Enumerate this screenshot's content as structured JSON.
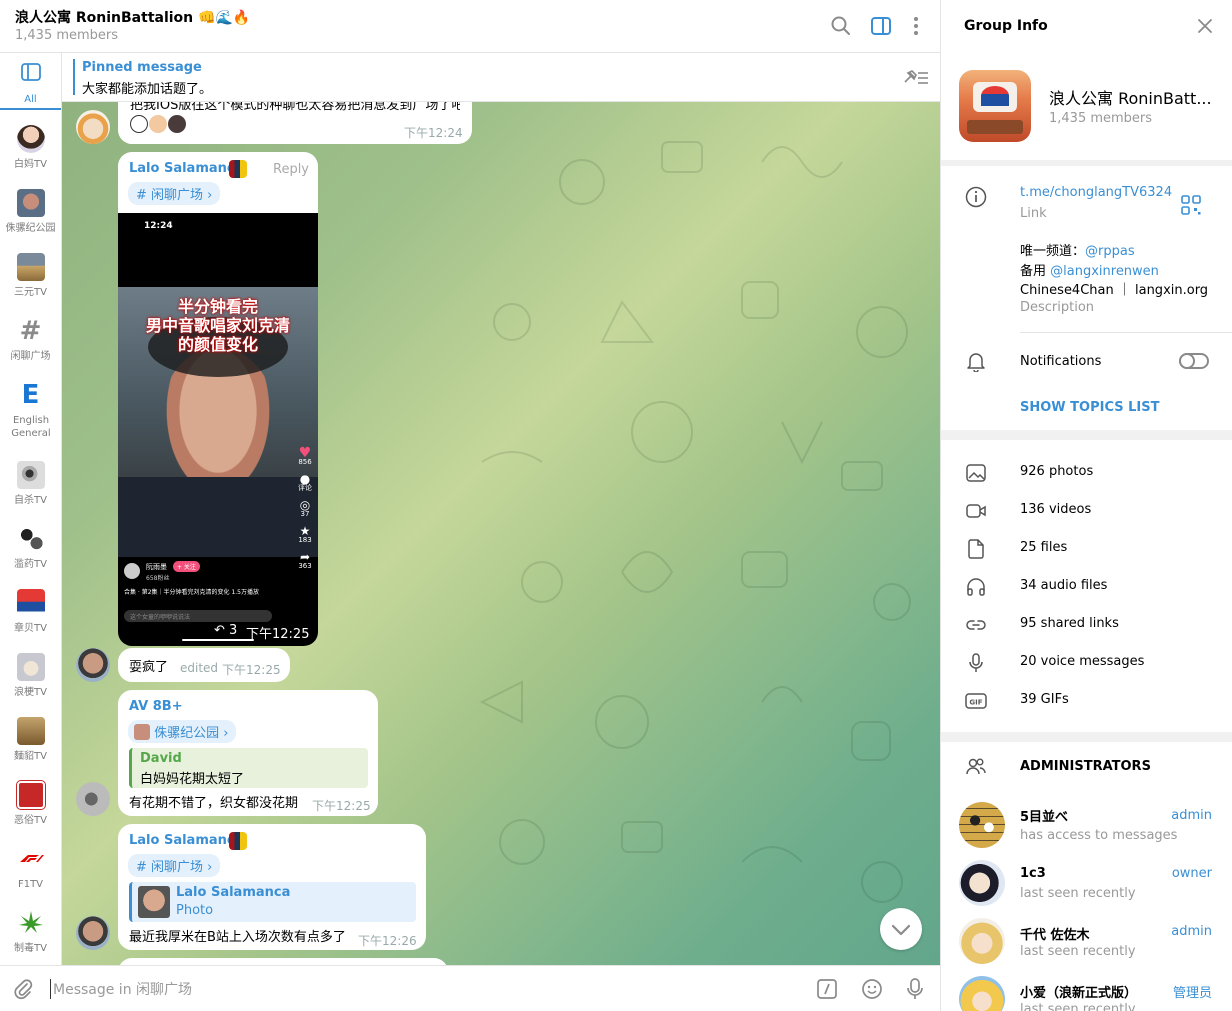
{
  "chat": {
    "title": "浪人公寓 RoninBattalion 👊🌊🔥",
    "subtitle": "1,435 members",
    "pinned": {
      "label": "Pinned message",
      "text": "大家都能添加话题了。"
    },
    "composer_placeholder": "Message in 闲聊广场"
  },
  "topics": [
    {
      "label": "All"
    },
    {
      "label": "白妈TV"
    },
    {
      "label": "侏骡纪公园"
    },
    {
      "label": "三元TV"
    },
    {
      "label": "闲聊广场"
    },
    {
      "label": "English General"
    },
    {
      "label": "自杀TV"
    },
    {
      "label": "滥药TV"
    },
    {
      "label": "章贝TV"
    },
    {
      "label": "浪梗TV"
    },
    {
      "label": "麵貂TV"
    },
    {
      "label": "恶俗TV"
    },
    {
      "label": "F1TV"
    },
    {
      "label": "制毒TV"
    }
  ],
  "messages": {
    "m0": {
      "partial_text": "把我IOS版往这个模式的种聊也太容易把消息发到广场了吧",
      "time": "下午12:24"
    },
    "m1": {
      "sender": "Lalo Salamanca",
      "reply": "Reply",
      "topic": "# 闲聊广场 ›",
      "video": {
        "status_time": "12:24",
        "caption": "半分钟看完\n男中音歌唱家刘克清\n的颜值变化",
        "likes": "856",
        "comments": "评论",
        "shares": "37",
        "stars": "183",
        "forwards": "363",
        "author": "阮雨墨",
        "follow": "+ 关注",
        "fans": "658粉丝",
        "collection": "合集 · 第2集｜半分钟看完刘克清的变化 1.5万播放",
        "comment_box": "这个女童的咿咿说说法",
        "replies": "3",
        "time": "下午12:25"
      }
    },
    "m2": {
      "text": "耍疯了",
      "edited": "edited",
      "time": "下午12:25"
    },
    "m3": {
      "sender": "AV 8B+",
      "topic": "侏骡纪公园 ›",
      "quote_name": "David",
      "quote_text": "白妈妈花期太短了",
      "text": "有花期不错了，织女都没花期",
      "time": "下午12:25"
    },
    "m4": {
      "sender": "Lalo Salamanca",
      "topic": "# 闲聊广场 ›",
      "quote_name": "Lalo Salamanca",
      "quote_text": "Photo",
      "text": "最近我厚米在B站上入场次数有点多了",
      "time": "下午12:26"
    }
  },
  "info": {
    "header": "Group Info",
    "name": "浪人公寓 RoninBatt...",
    "members": "1,435 members",
    "link": "t.me/chonglangTV6324",
    "link_label": "Link",
    "desc_line1_prefix": "唯一频道：",
    "desc_line1_link": "@rppas",
    "desc_line2_prefix": "备用 ",
    "desc_line2_link": "@langxinrenwen",
    "desc_line3": "Chinese4Chan ｜ langxin.org",
    "desc_label": "Description",
    "notifications": "Notifications",
    "notifications_on": false,
    "show_topics": "SHOW TOPICS LIST",
    "media": [
      {
        "icon": "photo-icon",
        "label": "926 photos"
      },
      {
        "icon": "video-icon",
        "label": "136 videos"
      },
      {
        "icon": "file-icon",
        "label": "25 files"
      },
      {
        "icon": "headphones-icon",
        "label": "34 audio files"
      },
      {
        "icon": "link-icon",
        "label": "95 shared links"
      },
      {
        "icon": "microphone-icon",
        "label": "20 voice messages"
      },
      {
        "icon": "gif-icon",
        "label": "39 GIFs"
      }
    ],
    "admins_title": "ADMINISTRATORS",
    "admins": [
      {
        "name": "5目並べ",
        "status": "has access to messages",
        "role": "admin"
      },
      {
        "name": "1c3",
        "status": "last seen recently",
        "role": "owner"
      },
      {
        "name": "千代 佐佐木",
        "status": "last seen recently",
        "role": "admin"
      },
      {
        "name": "小爱（浪新正式版）",
        "status": "last seen recently",
        "role": "管理员"
      }
    ]
  },
  "colors": {
    "accent": "#3a8fd4",
    "muted": "#999999",
    "bg_green": "#8fb27f"
  }
}
